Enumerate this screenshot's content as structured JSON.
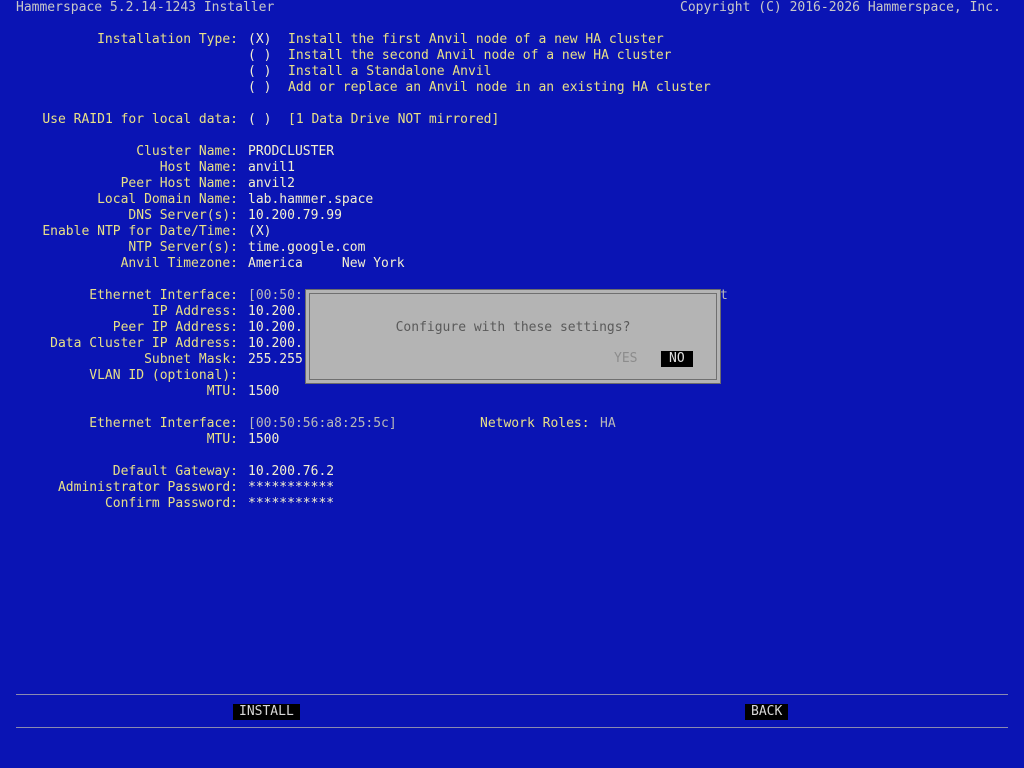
{
  "header": {
    "title": "Hammerspace 5.2.14-1243 Installer",
    "copyright": "Copyright (C) 2016-2026 Hammerspace, Inc."
  },
  "install_type": {
    "label": "Installation Type:",
    "options": [
      {
        "mark": "(X)",
        "text": "Install the first Anvil node of a new HA cluster"
      },
      {
        "mark": "( )",
        "text": "Install the second Anvil node of a new HA cluster"
      },
      {
        "mark": "( )",
        "text": "Install a Standalone Anvil"
      },
      {
        "mark": "( )",
        "text": "Add or replace an Anvil node in an existing HA cluster"
      }
    ]
  },
  "raid": {
    "label": "Use RAID1 for local data:",
    "mark": "( )",
    "note": "[1 Data Drive NOT mirrored]"
  },
  "settings": [
    {
      "label": "Cluster Name:",
      "value": "PRODCLUSTER"
    },
    {
      "label": "Host Name:",
      "value": "anvil1"
    },
    {
      "label": "Peer Host Name:",
      "value": "anvil2"
    },
    {
      "label": "Local Domain Name:",
      "value": "lab.hammer.space"
    },
    {
      "label": "DNS Server(s):",
      "value": "10.200.79.99"
    },
    {
      "label": "Enable NTP for Date/Time:",
      "value": "(X)"
    },
    {
      "label": "NTP Server(s):",
      "value": "time.google.com"
    },
    {
      "label": "Anvil Timezone:",
      "value": "America     New York"
    }
  ],
  "iface1": {
    "label": "Ethernet Interface:",
    "value": "[00:50:",
    "trail": "t",
    "fields": [
      {
        "label": "IP Address:",
        "value": "10.200."
      },
      {
        "label": "Peer IP Address:",
        "value": "10.200."
      },
      {
        "label": "Data Cluster IP Address:",
        "value": "10.200."
      },
      {
        "label": "Subnet Mask:",
        "value": "255.255"
      },
      {
        "label": "VLAN ID (optional):",
        "value": ""
      },
      {
        "label": "MTU:",
        "value": "1500"
      }
    ]
  },
  "iface2": {
    "label": "Ethernet Interface:",
    "value": "[00:50:56:a8:25:5c]",
    "roles_label": "Network Roles:",
    "roles_value": "HA",
    "mtu_label": "MTU:",
    "mtu_value": "1500"
  },
  "final": [
    {
      "label": "Default Gateway:",
      "value": "10.200.76.2"
    },
    {
      "label": "Administrator Password:",
      "value": "***********"
    },
    {
      "label": "Confirm Password:",
      "value": "***********"
    }
  ],
  "dialog": {
    "message": "Configure with these settings?",
    "yes": "YES",
    "no": "NO"
  },
  "footer": {
    "install": "INSTALL",
    "back": "BACK"
  }
}
